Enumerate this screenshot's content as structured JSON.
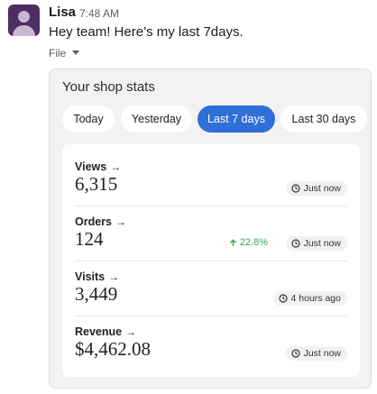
{
  "message": {
    "sender": "Lisa",
    "time": "7:48 AM",
    "text": "Hey team! Here’s my last 7days.",
    "file_label": "File"
  },
  "card": {
    "title": "Your shop stats",
    "tabs": [
      {
        "label": "Today",
        "active": false
      },
      {
        "label": "Yesterday",
        "active": false
      },
      {
        "label": "Last 7 days",
        "active": true
      },
      {
        "label": "Last 30 days",
        "active": false
      }
    ],
    "stats": [
      {
        "label": "Views",
        "value": "6,315",
        "updated": "Just now",
        "trend": null
      },
      {
        "label": "Orders",
        "value": "124",
        "updated": "Just now",
        "trend": "22.8%"
      },
      {
        "label": "Visits",
        "value": "3,449",
        "updated": "4 hours ago",
        "trend": null
      },
      {
        "label": "Revenue",
        "value": "$4,462.08",
        "updated": "Just now",
        "trend": null
      }
    ]
  },
  "colors": {
    "avatar": "#4f2d63",
    "active_tab": "#2e6fd8",
    "trend_up": "#3aa35b"
  },
  "icons": {
    "label_arrow": "arrow-right-icon",
    "badge": "clock-icon",
    "trend": "arrow-up-icon",
    "file_menu": "chevron-down-icon"
  }
}
